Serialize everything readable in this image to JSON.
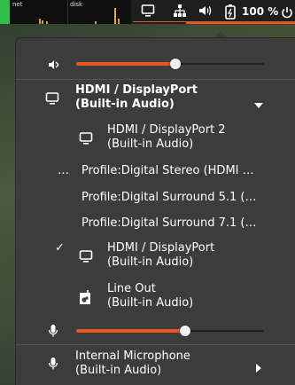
{
  "topbar": {
    "net_label": "net",
    "disk_label": "disk",
    "battery_text": "100 %",
    "accent": "#e95420"
  },
  "menu": {
    "volume_slider": {
      "level": 0.53
    },
    "output_device": {
      "line1": "HDMI / DisplayPort",
      "line2": "(Built-in Audio)"
    },
    "devices": [
      {
        "line1": "HDMI / DisplayPort 2",
        "line2": "(Built-in Audio)",
        "icon": "monitor-icon"
      }
    ],
    "profiles": [
      {
        "label": "Profile:Digital Stereo (HDMI …",
        "marker": "…"
      },
      {
        "label": "Profile:Digital Surround 5.1 (…"
      },
      {
        "label": "Profile:Digital Surround 7.1 (…"
      }
    ],
    "selected_device": {
      "line1": "HDMI / DisplayPort",
      "line2": "(Built-in Audio)",
      "check": "✓"
    },
    "line_out": {
      "line1": "Line Out",
      "line2": "(Built-in Audio)"
    },
    "mic_slider": {
      "level": 0.58
    },
    "input_device": {
      "line1": "Internal Microphone",
      "line2": "(Built-in Audio)"
    }
  }
}
